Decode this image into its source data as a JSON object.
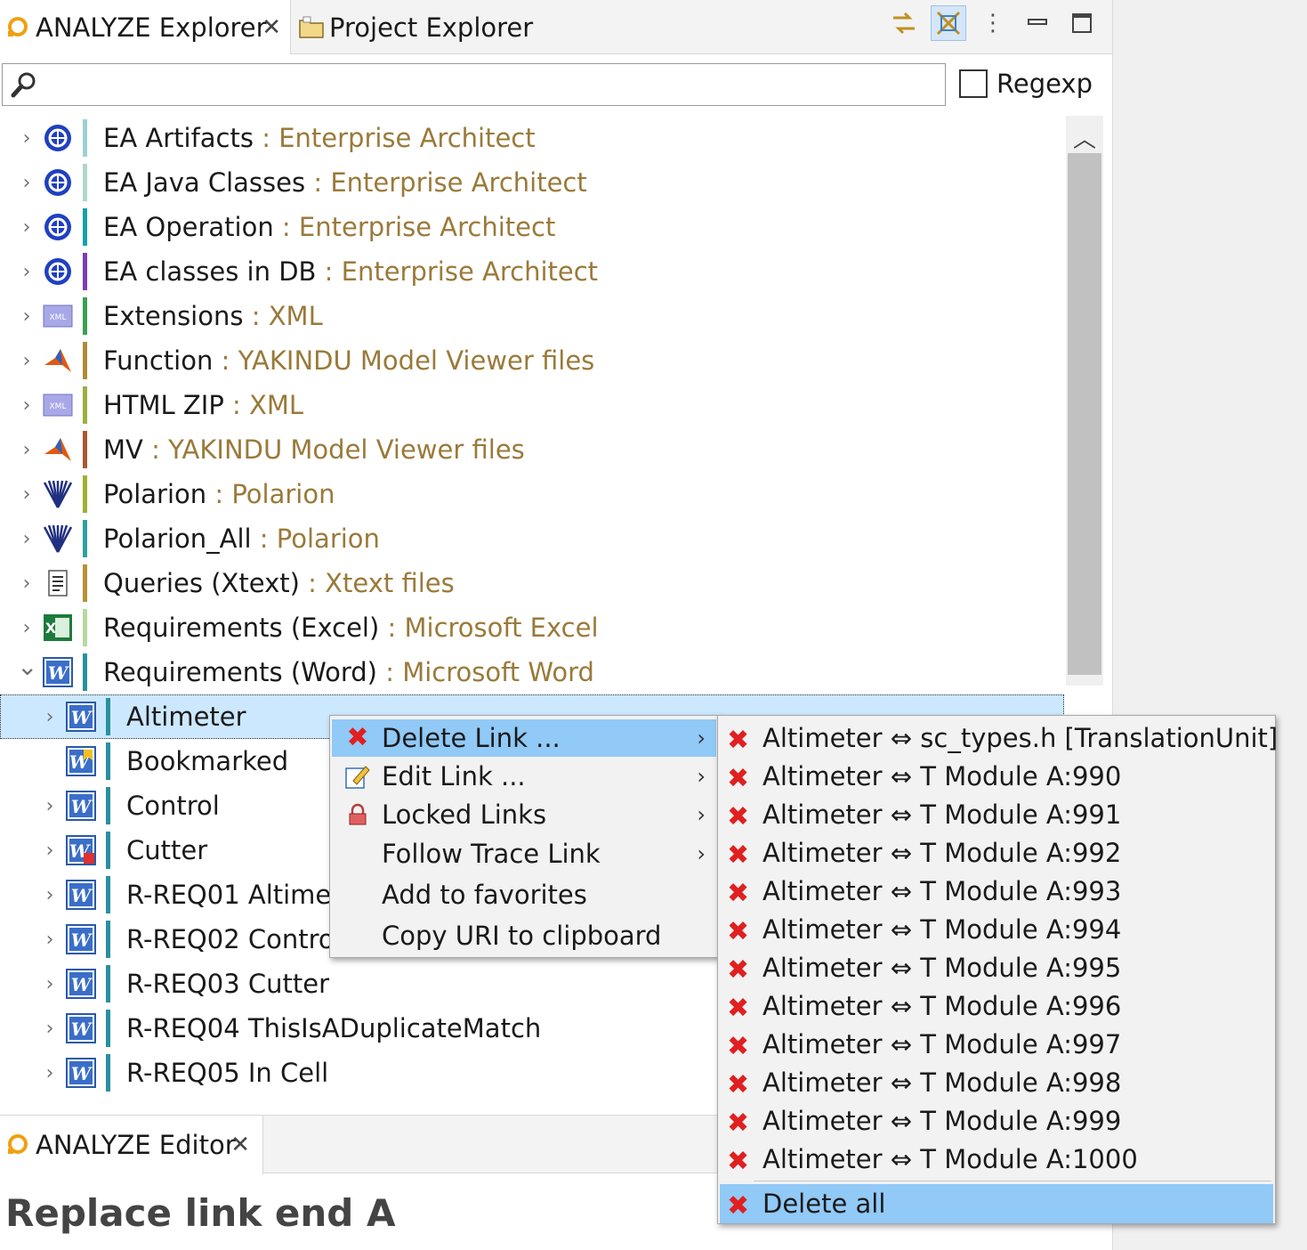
{
  "tabs": {
    "analyze_explorer": "ANALYZE Explorer",
    "project_explorer": "Project Explorer"
  },
  "search": {
    "placeholder": "",
    "value": "",
    "regexp_label": "Regexp"
  },
  "tree": [
    {
      "label": "EA Artifacts",
      "sub": " : Enterprise Architect",
      "icon": "ea-icon",
      "bar": "#9ed0d0"
    },
    {
      "label": "EA Java Classes",
      "sub": " : Enterprise Architect",
      "icon": "ea-icon",
      "bar": "#b0d8c8"
    },
    {
      "label": "EA Operation",
      "sub": " : Enterprise Architect",
      "icon": "ea-icon",
      "bar": "#18a0a8"
    },
    {
      "label": "EA classes in DB",
      "sub": " : Enterprise Architect",
      "icon": "ea-icon",
      "bar": "#7b3fb0"
    },
    {
      "label": "Extensions",
      "sub": " : XML",
      "icon": "xml-icon",
      "bar": "#3aa050"
    },
    {
      "label": "Function",
      "sub": " : YAKINDU Model Viewer files",
      "icon": "matlab-icon",
      "bar": "#b08a3a"
    },
    {
      "label": "HTML ZIP",
      "sub": " : XML",
      "icon": "xml-icon",
      "bar": "#9ab040"
    },
    {
      "label": "MV",
      "sub": " : YAKINDU Model Viewer files",
      "icon": "matlab-icon",
      "bar": "#a85a30"
    },
    {
      "label": "Polarion",
      "sub": " : Polarion",
      "icon": "polarion-icon",
      "bar": "#a0b030"
    },
    {
      "label": "Polarion_All",
      "sub": " : Polarion",
      "icon": "polarion-icon",
      "bar": "#30a0a0"
    },
    {
      "label": "Queries (Xtext)",
      "sub": " : Xtext files",
      "icon": "xtext-icon",
      "bar": "#b89038"
    },
    {
      "label": "Requirements (Excel)",
      "sub": " : Microsoft Excel",
      "icon": "excel-icon",
      "bar": "#b8d8a0"
    },
    {
      "label": "Requirements (Word)",
      "sub": " : Microsoft Word",
      "icon": "word-icon",
      "bar": "#2890a0"
    },
    {
      "label": "Altimeter",
      "sub": "",
      "icon": "word-icon",
      "bar": "#2890a0"
    },
    {
      "label": "Bookmarked",
      "sub": "",
      "icon": "word-bookmark-icon",
      "bar": "#2890a0"
    },
    {
      "label": "Control",
      "sub": "",
      "icon": "word-icon",
      "bar": "#2890a0"
    },
    {
      "label": "Cutter",
      "sub": "",
      "icon": "word-cutter-icon",
      "bar": "#2890a0"
    },
    {
      "label": "R-REQ01 Altimeter",
      "sub": "",
      "icon": "word-icon",
      "bar": "#2890a0"
    },
    {
      "label": "R-REQ02 Control",
      "sub": "",
      "icon": "word-icon",
      "bar": "#2890a0"
    },
    {
      "label": "R-REQ03 Cutter",
      "sub": "",
      "icon": "word-icon",
      "bar": "#2890a0"
    },
    {
      "label": "R-REQ04 ThisIsADuplicateMatch",
      "sub": "",
      "icon": "word-icon",
      "bar": "#2890a0"
    },
    {
      "label": "R-REQ05 In Cell",
      "sub": "",
      "icon": "word-icon",
      "bar": "#2890a0"
    }
  ],
  "context_menu": [
    {
      "label": "Delete Link ...",
      "icon": "delete-icon",
      "submenu": true
    },
    {
      "label": "Edit Link ...",
      "icon": "edit-icon",
      "submenu": true
    },
    {
      "label": "Locked Links",
      "icon": "lock-icon",
      "submenu": true
    },
    {
      "label": "Follow Trace Link",
      "icon": "",
      "submenu": true
    },
    {
      "label": "Add to favorites",
      "icon": "",
      "submenu": false
    },
    {
      "label": "Copy URI to clipboard",
      "icon": "",
      "submenu": false
    }
  ],
  "delete_submenu": [
    "Altimeter ⇔ sc_types.h [TranslationUnit]",
    "Altimeter ⇔ T Module A:990",
    "Altimeter ⇔ T Module A:991",
    "Altimeter ⇔ T Module A:992",
    "Altimeter ⇔ T Module A:993",
    "Altimeter ⇔ T Module A:994",
    "Altimeter ⇔ T Module A:995",
    "Altimeter ⇔ T Module A:996",
    "Altimeter ⇔ T Module A:997",
    "Altimeter ⇔ T Module A:998",
    "Altimeter ⇔ T Module A:999",
    "Altimeter ⇔ T Module A:1000"
  ],
  "delete_all_label": "Delete all",
  "editor": {
    "tab_label": "ANALYZE Editor",
    "title": "Replace link end A"
  },
  "colors": {
    "accent_orange": "#f0a010",
    "selection": "#cce8ff",
    "menu_highlight": "#91c9f7",
    "sub_text": "#9a7a3a",
    "delete_red": "#e02020"
  }
}
